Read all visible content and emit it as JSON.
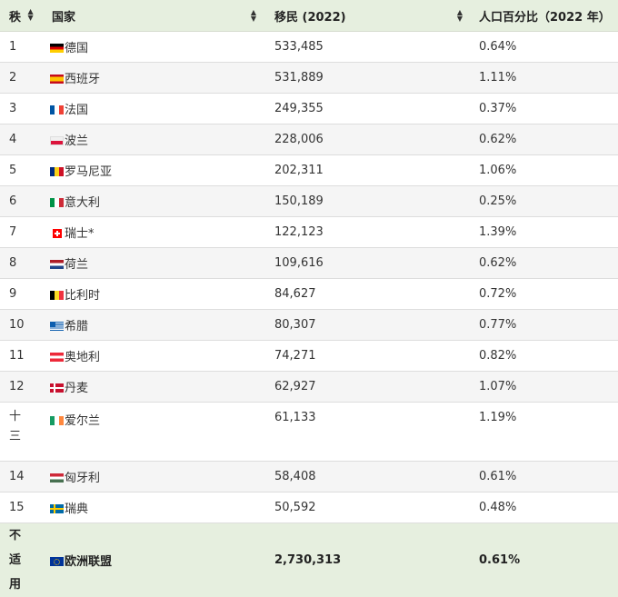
{
  "table": {
    "headers": [
      "秩",
      "国家",
      "移民 (2022)",
      "人口百分比（2022 年）"
    ],
    "rows": [
      {
        "rank": "1",
        "flag": "de",
        "flag_icon": "germany-flag-icon",
        "country": "德国",
        "immigrants": "533,485",
        "percent": "0.64%"
      },
      {
        "rank": "2",
        "flag": "es",
        "flag_icon": "spain-flag-icon",
        "country": "西班牙",
        "immigrants": "531,889",
        "percent": "1.11%"
      },
      {
        "rank": "3",
        "flag": "fr",
        "flag_icon": "france-flag-icon",
        "country": "法国",
        "immigrants": "249,355",
        "percent": "0.37%"
      },
      {
        "rank": "4",
        "flag": "pl",
        "flag_icon": "poland-flag-icon",
        "country": "波兰",
        "immigrants": "228,006",
        "percent": "0.62%"
      },
      {
        "rank": "5",
        "flag": "ro",
        "flag_icon": "romania-flag-icon",
        "country": "罗马尼亚",
        "immigrants": "202,311",
        "percent": "1.06%"
      },
      {
        "rank": "6",
        "flag": "it",
        "flag_icon": "italy-flag-icon",
        "country": "意大利",
        "immigrants": "150,189",
        "percent": "0.25%"
      },
      {
        "rank": "7",
        "flag": "ch",
        "flag_icon": "switzerland-flag-icon",
        "country": "瑞士*",
        "immigrants": "122,123",
        "percent": "1.39%"
      },
      {
        "rank": "8",
        "flag": "nl",
        "flag_icon": "netherlands-flag-icon",
        "country": "荷兰",
        "immigrants": "109,616",
        "percent": "0.62%"
      },
      {
        "rank": "9",
        "flag": "be",
        "flag_icon": "belgium-flag-icon",
        "country": "比利时",
        "immigrants": "84,627",
        "percent": "0.72%"
      },
      {
        "rank": "10",
        "flag": "gr",
        "flag_icon": "greece-flag-icon",
        "country": "希腊",
        "immigrants": "80,307",
        "percent": "0.77%"
      },
      {
        "rank": "11",
        "flag": "at",
        "flag_icon": "austria-flag-icon",
        "country": "奥地利",
        "immigrants": "74,271",
        "percent": "0.82%"
      },
      {
        "rank": "12",
        "flag": "dk",
        "flag_icon": "denmark-flag-icon",
        "country": "丹麦",
        "immigrants": "62,927",
        "percent": "1.07%"
      },
      {
        "rank": "十三",
        "flag": "ie",
        "flag_icon": "ireland-flag-icon",
        "country": "爱尔兰",
        "immigrants": "61,133",
        "percent": "1.19%"
      },
      {
        "rank": "14",
        "flag": "hu",
        "flag_icon": "hungary-flag-icon",
        "country": "匈牙利",
        "immigrants": "58,408",
        "percent": "0.61%"
      },
      {
        "rank": "15",
        "flag": "se",
        "flag_icon": "sweden-flag-icon",
        "country": "瑞典",
        "immigrants": "50,592",
        "percent": "0.48%"
      }
    ],
    "total": {
      "rank": "不适用",
      "flag": "eu",
      "flag_icon": "eu-flag-icon",
      "country": "欧洲联盟",
      "immigrants": "2,730,313",
      "percent": "0.61%"
    },
    "sort_icon": "sort-arrows-icon",
    "colors": {
      "header_bg": "#e6efdf",
      "stripe_bg": "#f5f5f5",
      "border": "#dddddd"
    }
  }
}
